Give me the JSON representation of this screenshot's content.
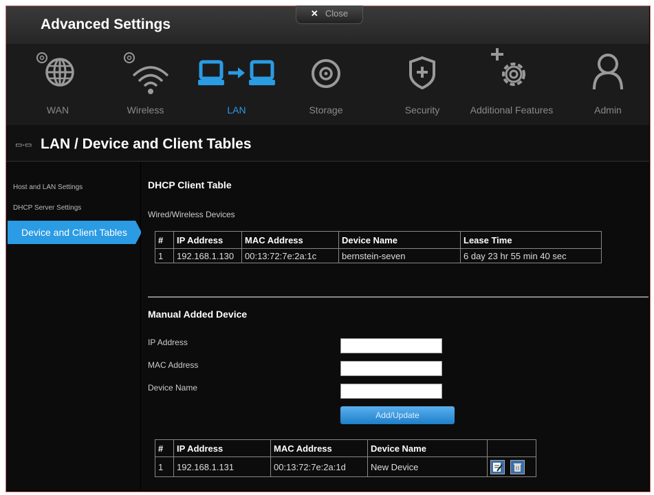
{
  "window": {
    "title": "Advanced Settings",
    "close_label": "Close",
    "close_symbol": "✕"
  },
  "nav": [
    {
      "label": "WAN",
      "icon": "globe-gear-icon"
    },
    {
      "label": "Wireless",
      "icon": "wifi-gear-icon"
    },
    {
      "label": "LAN",
      "icon": "lan-computers-icon",
      "active": true
    },
    {
      "label": "Storage",
      "icon": "disk-icon"
    },
    {
      "label": "Security",
      "icon": "shield-plus-icon"
    },
    {
      "label": "Additional Features",
      "icon": "gear-plus-icon"
    },
    {
      "label": "Admin",
      "icon": "user-icon"
    }
  ],
  "page": {
    "title": "LAN / Device and Client Tables",
    "icon": "lan-small-icon"
  },
  "sidebar": {
    "items": [
      {
        "label": "Host and LAN Settings"
      },
      {
        "label": "DHCP Server Settings"
      },
      {
        "label": "Device and Client Tables",
        "active": true
      }
    ]
  },
  "dhcp": {
    "title": "DHCP Client Table",
    "subtitle": "Wired/Wireless Devices",
    "headers": [
      "#",
      "IP Address",
      "MAC Address",
      "Device Name",
      "Lease Time"
    ],
    "rows": [
      [
        "1",
        "192.168.1.130",
        "00:13:72:7e:2a:1c",
        "bernstein-seven",
        "6 day 23 hr 55 min 40 sec"
      ]
    ]
  },
  "manual": {
    "title": "Manual Added Device",
    "fields": {
      "ip_label": "IP Address",
      "ip_value": "",
      "mac_label": "MAC Address",
      "mac_value": "",
      "name_label": "Device Name",
      "name_value": ""
    },
    "button": "Add/Update",
    "headers": [
      "#",
      "IP Address",
      "MAC Address",
      "Device Name",
      ""
    ],
    "rows": [
      [
        "1",
        "192.168.1.131",
        "00:13:72:7e:2a:1d",
        "New Device"
      ]
    ]
  },
  "colors": {
    "accent": "#2b9be4",
    "background": "#0c0c0c",
    "header": "#2e2e2e"
  }
}
